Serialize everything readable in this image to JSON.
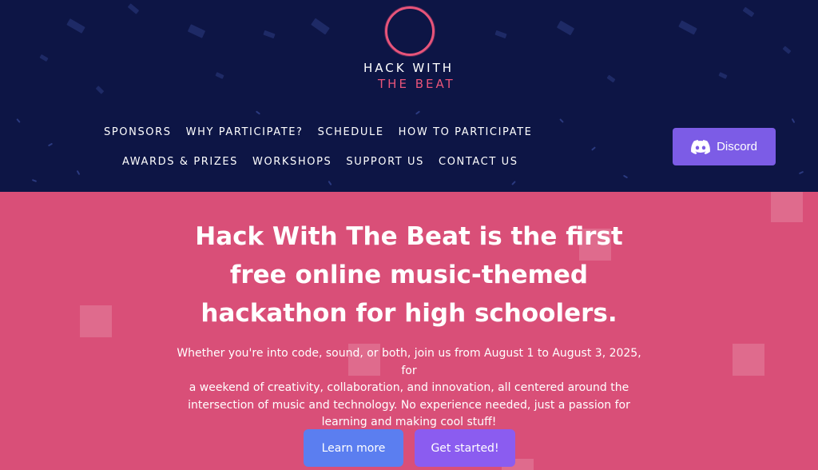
{
  "logo": {
    "line1": "HACK WITH",
    "line2": "THE BEAT",
    "icon": "soundwave-icon"
  },
  "nav": {
    "row1": [
      "SPONSORS",
      "WHY PARTICIPATE?",
      "SCHEDULE",
      "HOW TO PARTICIPATE"
    ],
    "row2": [
      "AWARDS & PRIZES",
      "WORKSHOPS",
      "SUPPORT US",
      "CONTACT US"
    ]
  },
  "discord": {
    "label": "Discord",
    "icon": "discord-icon",
    "color": "#7c5ce6"
  },
  "hero": {
    "title_line1": "Hack With The Beat is the first",
    "title_line2": "free online music-themed",
    "title_line3": "hackathon for high schoolers.",
    "desc_line1": "Whether you're into code, sound, or both, join us from August 1 to August 3, 2025, for",
    "desc_line2": "a weekend of creativity, collaboration, and innovation, all centered around the",
    "desc_line3": "intersection of music and technology. No experience needed, just a passion for",
    "desc_line4": "learning and making cool stuff!",
    "learn_more_label": "Learn more",
    "get_started_label": "Get started!",
    "background_color": "#d94f78"
  },
  "colors": {
    "header_bg": "#0d1545",
    "accent_pink": "#e8547a",
    "learn_more_bg": "#5b7ef0",
    "get_started_bg": "#8b5cf0"
  }
}
